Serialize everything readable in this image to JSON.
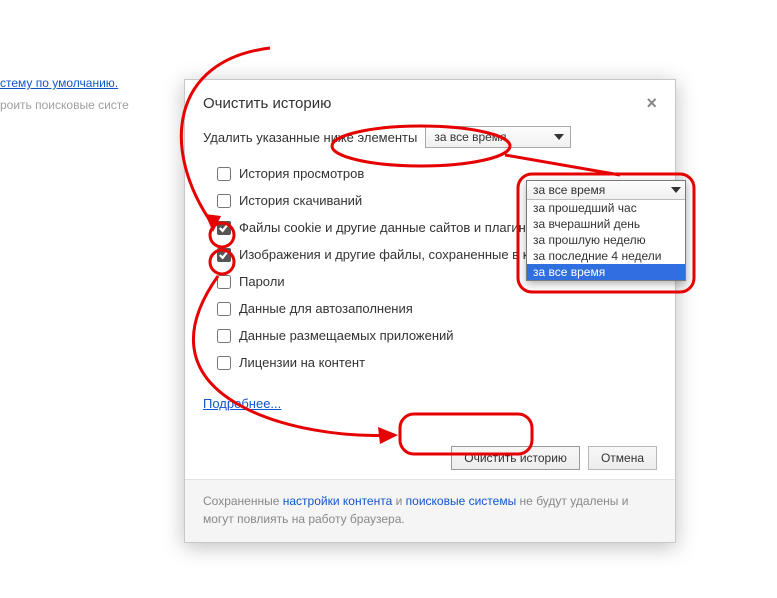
{
  "bg": {
    "link1": "стему по умолчанию.",
    "cut": "роить поисковые систе"
  },
  "dialog": {
    "title": "Очистить историю",
    "delete_label": "Удалить указанные ниже элементы",
    "select_value": "за все время",
    "more_link": "Подробнее...",
    "primary_btn": "Очистить историю",
    "cancel_btn": "Отмена",
    "footer_pre": "Сохраненные ",
    "footer_link1": "настройки контента",
    "footer_mid": " и ",
    "footer_link2": "поисковые системы",
    "footer_post": " не будут удалены и могут повлиять на работу браузера."
  },
  "checks": [
    {
      "label": "История просмотров",
      "checked": false
    },
    {
      "label": "История скачиваний",
      "checked": false
    },
    {
      "label": "Файлы cookie и другие данные сайтов и плагинов",
      "checked": true
    },
    {
      "label": "Изображения и другие файлы, сохраненные в кеше",
      "checked": true
    },
    {
      "label": "Пароли",
      "checked": false
    },
    {
      "label": "Данные для автозаполнения",
      "checked": false
    },
    {
      "label": "Данные размещаемых приложений",
      "checked": false
    },
    {
      "label": "Лицензии на контент",
      "checked": false
    }
  ],
  "dropdown": {
    "head": "за все время",
    "options": [
      "за прошедший час",
      "за вчерашний день",
      "за прошлую неделю",
      "за последние 4 недели",
      "за все время"
    ],
    "highlight_index": 4
  }
}
